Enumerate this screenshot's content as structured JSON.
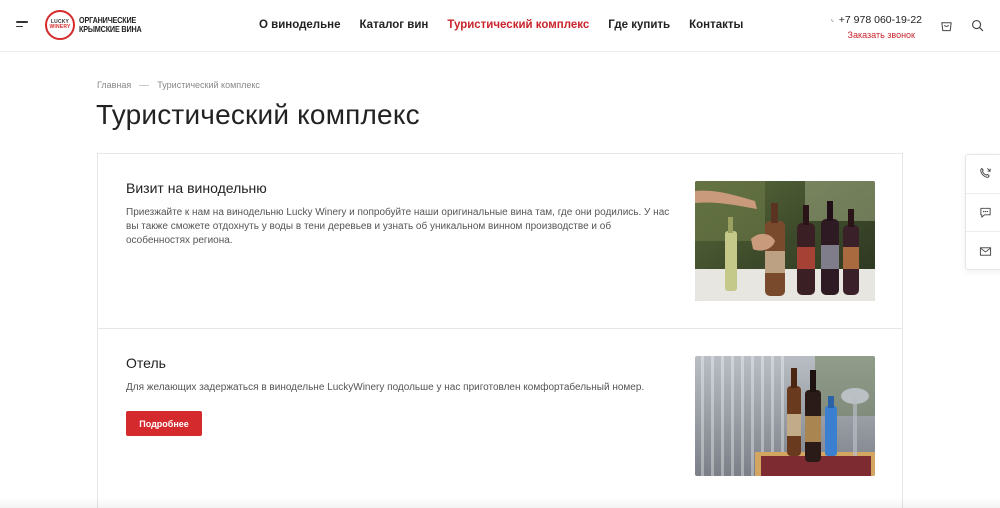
{
  "header": {
    "logo_mark_top": "LUCKY",
    "logo_mark_bottom": "WINERY",
    "logo_line1": "ОРГАНИЧЕСКИЕ",
    "logo_line2": "КРЫМСКИЕ ВИНА",
    "nav": [
      {
        "label": "О винодельне",
        "active": false
      },
      {
        "label": "Каталог вин",
        "active": false
      },
      {
        "label": "Туристический комплекс",
        "active": true
      },
      {
        "label": "Где купить",
        "active": false
      },
      {
        "label": "Контакты",
        "active": false
      }
    ],
    "phone": "+7 978 060-19-22",
    "callback": "Заказать звонок",
    "icons": [
      "menu-icon",
      "phone-icon",
      "cart-icon",
      "search-icon"
    ]
  },
  "breadcrumb": {
    "home": "Главная",
    "current": "Туристический комплекс"
  },
  "page_title": "Туристический комплекс",
  "cards": [
    {
      "title": "Визит на винодельню",
      "text": "Приезжайте к нам на винодельню Lucky Winery и попробуйте наши оригинальные вина там, где они родились. У нас вы также сможете отдохнуть у воды в тени деревьев и узнать об уникальном винном производстве и об особенностях региона."
    },
    {
      "title": "Отель",
      "text": "Для желающих задержаться в винодельне LuckyWinery подольше у нас приготовлен комфортабельный номер.",
      "button": "Подробнее"
    }
  ],
  "side_widget": [
    "phone-callback-icon",
    "chat-icon",
    "mail-icon"
  ],
  "colors": {
    "accent": "#c9252c",
    "button": "#d42a2e",
    "text": "#222222",
    "muted": "#888888",
    "border": "#e6e6e6"
  }
}
